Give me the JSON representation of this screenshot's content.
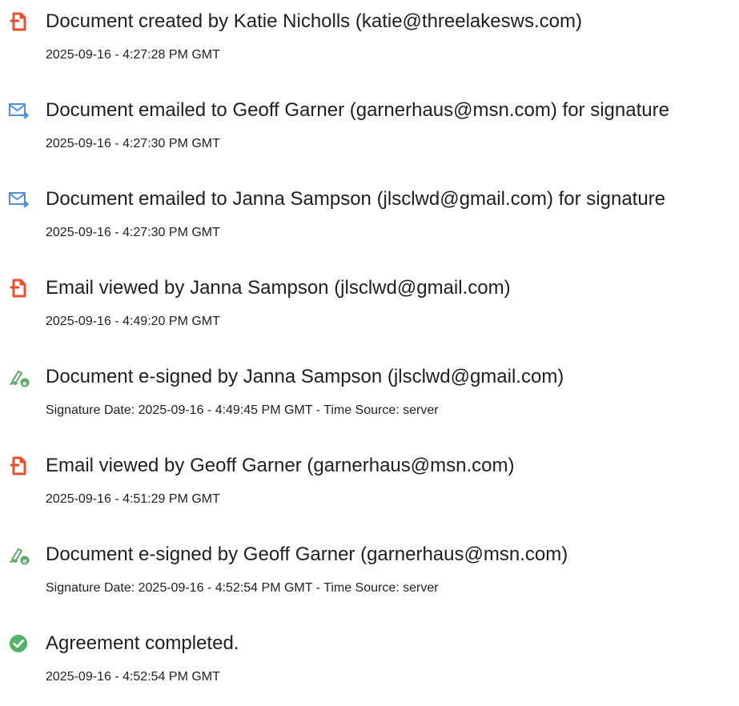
{
  "events": [
    {
      "icon": "document-created-icon",
      "title": "Document created by Katie Nicholls (katie@threelakesws.com)",
      "meta": "2025-09-16 - 4:27:28 PM GMT"
    },
    {
      "icon": "email-sent-icon",
      "title": "Document emailed to Geoff Garner (garnerhaus@msn.com) for signature",
      "meta": "2025-09-16 - 4:27:30 PM GMT"
    },
    {
      "icon": "email-sent-icon",
      "title": "Document emailed to Janna Sampson (jlsclwd@gmail.com) for signature",
      "meta": "2025-09-16 - 4:27:30 PM GMT"
    },
    {
      "icon": "email-viewed-icon",
      "title": "Email viewed by Janna Sampson (jlsclwd@gmail.com)",
      "meta": "2025-09-16 - 4:49:20 PM GMT"
    },
    {
      "icon": "e-signed-icon",
      "title": "Document e-signed by Janna Sampson (jlsclwd@gmail.com)",
      "meta": "Signature Date: 2025-09-16 - 4:49:45 PM GMT - Time Source: server"
    },
    {
      "icon": "email-viewed-icon",
      "title": "Email viewed by Geoff Garner (garnerhaus@msn.com)",
      "meta": "2025-09-16 - 4:51:29 PM GMT"
    },
    {
      "icon": "e-signed-icon",
      "title": "Document e-signed by Geoff Garner (garnerhaus@msn.com)",
      "meta": "Signature Date: 2025-09-16 - 4:52:54 PM GMT - Time Source: server"
    },
    {
      "icon": "completed-check-icon",
      "title": "Agreement completed.",
      "meta": "2025-09-16 - 4:52:54 PM GMT"
    }
  ],
  "colors": {
    "document_icon": "#e8502b",
    "email_icon": "#4f90d6",
    "signed_icon": "#5aa86b",
    "completed_icon": "#52b266"
  }
}
